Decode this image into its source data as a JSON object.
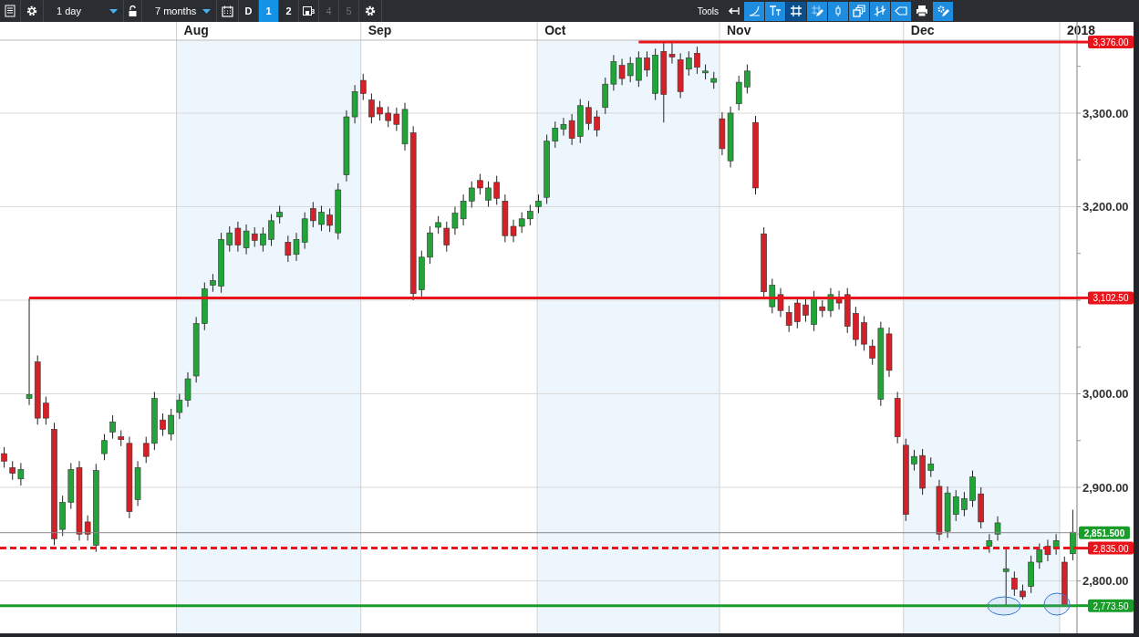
{
  "toolbar": {
    "interval": {
      "value": "1 day"
    },
    "range": {
      "value": "7 months"
    },
    "views": [
      {
        "label": "D",
        "kind": "text",
        "selected": false,
        "disabled": false
      },
      {
        "label": "1",
        "kind": "text",
        "selected": true,
        "disabled": false
      },
      {
        "label": "2",
        "kind": "text",
        "selected": false,
        "disabled": false
      },
      {
        "label": "3",
        "kind": "save",
        "selected": false,
        "disabled": false
      },
      {
        "label": "4",
        "kind": "text",
        "selected": false,
        "disabled": true
      },
      {
        "label": "5",
        "kind": "text",
        "selected": false,
        "disabled": true
      }
    ],
    "tools_label": "Tools",
    "tools": [
      {
        "kind": "back",
        "selected": false
      },
      {
        "kind": "curve",
        "selected": false
      },
      {
        "kind": "text",
        "selected": false
      },
      {
        "kind": "grid",
        "selected": true
      },
      {
        "kind": "grid-edit",
        "selected": false
      },
      {
        "kind": "candle",
        "selected": false
      },
      {
        "kind": "windows",
        "selected": false
      },
      {
        "kind": "bars",
        "selected": false
      },
      {
        "kind": "tag",
        "selected": false
      },
      {
        "kind": "print",
        "selected": false
      },
      {
        "kind": "settings",
        "selected": false
      }
    ]
  },
  "chart": {
    "chart_data": {
      "type": "candlestick",
      "grid": true,
      "categories": [
        null,
        null,
        null,
        null,
        null,
        null,
        null,
        null,
        null,
        null,
        null,
        null,
        null,
        null,
        null,
        null,
        null,
        null,
        null,
        null,
        null,
        null,
        null,
        "Aug",
        null,
        null,
        null,
        null,
        null,
        null,
        null,
        null,
        null,
        null,
        null,
        null,
        null,
        null,
        null,
        null,
        null,
        null,
        null,
        null,
        null,
        "Sep",
        null,
        null,
        null,
        null,
        null,
        null,
        null,
        null,
        null,
        null,
        null,
        null,
        null,
        null,
        null,
        null,
        null,
        null,
        null,
        null,
        "Oct",
        null,
        null,
        null,
        null,
        null,
        null,
        null,
        null,
        null,
        null,
        null,
        null,
        null,
        null,
        null,
        null,
        null,
        null,
        null,
        null,
        null,
        "Nov",
        null,
        null,
        null,
        null,
        null,
        null,
        null,
        null,
        null,
        null,
        null,
        null,
        null,
        null,
        null,
        null,
        null,
        null,
        null,
        null,
        null,
        "Dec",
        null,
        null,
        null,
        null,
        null,
        null,
        null,
        null,
        null,
        null,
        null,
        null,
        null,
        null,
        null,
        null,
        null,
        null,
        "2018",
        null
      ],
      "ohlc": [
        [
          2936,
          2943,
          2921,
          2928
        ],
        [
          2921,
          2928,
          2908,
          2915
        ],
        [
          2909,
          2926,
          2902,
          2919
        ],
        [
          2995,
          3102,
          2988,
          2999
        ],
        [
          3034,
          3041,
          2967,
          2974
        ],
        [
          2990,
          2997,
          2967,
          2974
        ],
        [
          2962,
          2969,
          2838,
          2845
        ],
        [
          2855,
          2891,
          2848,
          2884
        ],
        [
          2884,
          2926,
          2877,
          2919
        ],
        [
          2921,
          2928,
          2843,
          2850
        ],
        [
          2863,
          2870,
          2843,
          2850
        ],
        [
          2838,
          2925,
          2831,
          2918
        ],
        [
          2936,
          2957,
          2929,
          2950
        ],
        [
          2959,
          2977,
          2952,
          2970
        ],
        [
          2954,
          2961,
          2944,
          2951
        ],
        [
          2947,
          2954,
          2867,
          2874
        ],
        [
          2887,
          2928,
          2880,
          2921
        ],
        [
          2947,
          2954,
          2926,
          2933
        ],
        [
          2947,
          3002,
          2940,
          2995
        ],
        [
          2972,
          2979,
          2955,
          2962
        ],
        [
          2957,
          2984,
          2950,
          2977
        ],
        [
          2980,
          3000,
          2973,
          2993
        ],
        [
          2993,
          3023,
          2986,
          3016
        ],
        [
          3019,
          3082,
          3012,
          3075
        ],
        [
          3075,
          3119,
          3068,
          3112
        ],
        [
          3116,
          3128,
          3109,
          3121
        ],
        [
          3115,
          3172,
          3108,
          3165
        ],
        [
          3159,
          3179,
          3152,
          3172
        ],
        [
          3177,
          3184,
          3152,
          3159
        ],
        [
          3156,
          3181,
          3149,
          3174
        ],
        [
          3171,
          3178,
          3157,
          3164
        ],
        [
          3159,
          3178,
          3152,
          3171
        ],
        [
          3165,
          3192,
          3158,
          3185
        ],
        [
          3189,
          3201,
          3182,
          3194
        ],
        [
          3162,
          3169,
          3141,
          3148
        ],
        [
          3149,
          3172,
          3142,
          3165
        ],
        [
          3162,
          3194,
          3155,
          3187
        ],
        [
          3198,
          3205,
          3178,
          3185
        ],
        [
          3181,
          3201,
          3174,
          3194
        ],
        [
          3191,
          3198,
          3173,
          3180
        ],
        [
          3172,
          3225,
          3165,
          3218
        ],
        [
          3234,
          3303,
          3227,
          3296
        ],
        [
          3296,
          3330,
          3289,
          3323
        ],
        [
          3335,
          3342,
          3314,
          3321
        ],
        [
          3314,
          3321,
          3289,
          3296
        ],
        [
          3306,
          3313,
          3292,
          3299
        ],
        [
          3300,
          3307,
          3285,
          3292
        ],
        [
          3299,
          3306,
          3281,
          3288
        ],
        [
          3267,
          3311,
          3260,
          3304
        ],
        [
          3279,
          3286,
          3100,
          3107
        ],
        [
          3111,
          3153,
          3104,
          3146
        ],
        [
          3146,
          3179,
          3139,
          3172
        ],
        [
          3178,
          3190,
          3171,
          3183
        ],
        [
          3177,
          3184,
          3152,
          3159
        ],
        [
          3177,
          3200,
          3170,
          3193
        ],
        [
          3187,
          3213,
          3180,
          3206
        ],
        [
          3206,
          3227,
          3199,
          3220
        ],
        [
          3228,
          3235,
          3213,
          3220
        ],
        [
          3207,
          3227,
          3200,
          3220
        ],
        [
          3226,
          3233,
          3202,
          3209
        ],
        [
          3206,
          3213,
          3162,
          3169
        ],
        [
          3179,
          3186,
          3162,
          3169
        ],
        [
          3179,
          3194,
          3172,
          3187
        ],
        [
          3187,
          3202,
          3180,
          3195
        ],
        [
          3200,
          3213,
          3193,
          3206
        ],
        [
          3210,
          3277,
          3203,
          3270
        ],
        [
          3270,
          3291,
          3263,
          3284
        ],
        [
          3283,
          3295,
          3276,
          3288
        ],
        [
          3292,
          3299,
          3266,
          3273
        ],
        [
          3275,
          3315,
          3268,
          3308
        ],
        [
          3306,
          3313,
          3282,
          3289
        ],
        [
          3296,
          3303,
          3275,
          3282
        ],
        [
          3306,
          3338,
          3299,
          3331
        ],
        [
          3331,
          3362,
          3324,
          3355
        ],
        [
          3351,
          3358,
          3330,
          3337
        ],
        [
          3340,
          3360,
          3333,
          3353
        ],
        [
          3335,
          3366,
          3328,
          3359
        ],
        [
          3359,
          3366,
          3339,
          3346
        ],
        [
          3321,
          3369,
          3314,
          3362
        ],
        [
          3366,
          3376,
          3290,
          3320
        ],
        [
          3363,
          3376,
          3353,
          3360
        ],
        [
          3357,
          3364,
          3316,
          3323
        ],
        [
          3347,
          3366,
          3340,
          3359
        ],
        [
          3364,
          3371,
          3342,
          3349
        ],
        [
          3343,
          3352,
          3336,
          3345
        ],
        [
          3333,
          3344,
          3326,
          3337
        ],
        [
          3294,
          3301,
          3255,
          3262
        ],
        [
          3249,
          3307,
          3242,
          3300
        ],
        [
          3310,
          3340,
          3303,
          3333
        ],
        [
          3328,
          3352,
          3321,
          3345
        ],
        [
          3290,
          3297,
          3213,
          3220
        ],
        [
          3171,
          3178,
          3102,
          3109
        ],
        [
          3093,
          3123,
          3086,
          3116
        ],
        [
          3106,
          3113,
          3082,
          3089
        ],
        [
          3087,
          3094,
          3066,
          3073
        ],
        [
          3097,
          3104,
          3070,
          3077
        ],
        [
          3095,
          3102,
          3077,
          3084
        ],
        [
          3074,
          3110,
          3067,
          3103
        ],
        [
          3093,
          3100,
          3082,
          3089
        ],
        [
          3089,
          3113,
          3082,
          3106
        ],
        [
          3103,
          3110,
          3090,
          3097
        ],
        [
          3106,
          3113,
          3065,
          3072
        ],
        [
          3086,
          3093,
          3051,
          3058
        ],
        [
          3076,
          3083,
          3046,
          3053
        ],
        [
          3051,
          3058,
          3031,
          3038
        ],
        [
          2994,
          3077,
          2987,
          3070
        ],
        [
          3064,
          3071,
          3018,
          3025
        ],
        [
          2995,
          3002,
          2947,
          2954
        ],
        [
          2945,
          2952,
          2864,
          2871
        ],
        [
          2925,
          2940,
          2918,
          2933
        ],
        [
          2934,
          2941,
          2892,
          2899
        ],
        [
          2918,
          2932,
          2911,
          2925
        ],
        [
          2901,
          2908,
          2843,
          2850
        ],
        [
          2853,
          2901,
          2846,
          2894
        ],
        [
          2871,
          2897,
          2864,
          2890
        ],
        [
          2876,
          2895,
          2869,
          2888
        ],
        [
          2886,
          2918,
          2879,
          2911
        ],
        [
          2893,
          2900,
          2856,
          2863
        ],
        [
          2837,
          2850,
          2830,
          2843
        ],
        [
          2850,
          2869,
          2843,
          2862
        ],
        [
          2810,
          2836,
          2774,
          2813
        ],
        [
          2803,
          2810,
          2784,
          2791
        ],
        [
          2789,
          2796,
          2780,
          2783
        ],
        [
          2794,
          2827,
          2787,
          2820
        ],
        [
          2820,
          2840,
          2813,
          2833
        ],
        [
          2837,
          2844,
          2821,
          2828
        ],
        [
          2835,
          2850,
          2828,
          2843
        ],
        [
          2820,
          2826,
          2773,
          2774
        ],
        [
          2829,
          2876,
          2822,
          2852
        ],
        null,
        null
      ],
      "ylim": [
        2740,
        3378
      ],
      "yticks": [
        {
          "value": 2800,
          "label": "2,800.00"
        },
        {
          "value": 2900,
          "label": "2,900.00"
        },
        {
          "value": 3000,
          "label": "3,000.00"
        },
        {
          "value": 3200,
          "label": "3,200.00"
        },
        {
          "value": 3300,
          "label": "3,300.00"
        }
      ],
      "ref_lines": [
        {
          "axis": "y",
          "value": 3376,
          "label": "3,376.00",
          "color": "#e8141c"
        },
        {
          "axis": "y",
          "value": 3102.5,
          "label": "3,102.50",
          "color": "#e8141c"
        },
        {
          "axis": "y",
          "value": 2851.5,
          "label": "2,851.500",
          "color": "#888888"
        },
        {
          "axis": "y",
          "value": 2835,
          "label": "2,835.00",
          "color": "#e8141c"
        },
        {
          "axis": "y",
          "value": 2773.5,
          "label": "2,773.50",
          "color": "#1a9c2a"
        }
      ]
    }
  }
}
